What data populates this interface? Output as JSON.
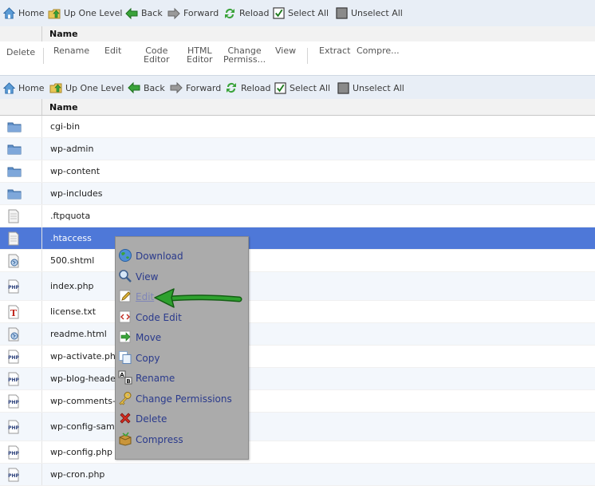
{
  "navbar": {
    "home": "Home",
    "up_one_level": "Up One Level",
    "back": "Back",
    "forward": "Forward",
    "reload": "Reload",
    "select_all": "Select All",
    "unselect_all": "Unselect All"
  },
  "table": {
    "name_header": "Name"
  },
  "toolbar": {
    "delete": "Delete",
    "rename": "Rename",
    "edit": "Edit",
    "code_editor_1": "Code",
    "code_editor_2": "Editor",
    "html_editor_1": "HTML",
    "html_editor_2": "Editor",
    "change_perm_1": "Change",
    "change_perm_2": "Permiss...",
    "view": "View",
    "extract": "Extract",
    "compress": "Compre..."
  },
  "files": [
    {
      "name": "cgi-bin",
      "icon": "folder-icon"
    },
    {
      "name": "wp-admin",
      "icon": "folder-icon"
    },
    {
      "name": "wp-content",
      "icon": "folder-icon"
    },
    {
      "name": "wp-includes",
      "icon": "folder-icon"
    },
    {
      "name": ".ftpquota",
      "icon": "file-icon"
    },
    {
      "name": ".htaccess",
      "icon": "file-icon",
      "selected": true
    },
    {
      "name": "500.shtml",
      "icon": "html-file-icon"
    },
    {
      "name": "index.php",
      "icon": "php-file-icon"
    },
    {
      "name": "license.txt",
      "icon": "text-file-icon"
    },
    {
      "name": "readme.html",
      "icon": "html-file-icon"
    },
    {
      "name": "wp-activate.php",
      "icon": "php-file-icon"
    },
    {
      "name": "wp-blog-header.",
      "icon": "php-file-icon"
    },
    {
      "name": "wp-comments-p",
      "icon": "php-file-icon"
    },
    {
      "name": "wp-config-samp",
      "icon": "php-file-icon"
    },
    {
      "name": "wp-config.php",
      "icon": "php-file-icon"
    },
    {
      "name": "wp-cron.php",
      "icon": "php-file-icon"
    }
  ],
  "context_menu": {
    "download": "Download",
    "view": "View",
    "edit": "Edit",
    "code_edit": "Code Edit",
    "move": "Move",
    "copy": "Copy",
    "rename": "Rename",
    "change_permissions": "Change Permissions",
    "delete": "Delete",
    "compress": "Compress"
  },
  "colors": {
    "selected_row": "#4e78d8",
    "menu_bg": "#ababab",
    "menu_text": "#2a3a8c",
    "arrow": "#1f8a1f"
  }
}
